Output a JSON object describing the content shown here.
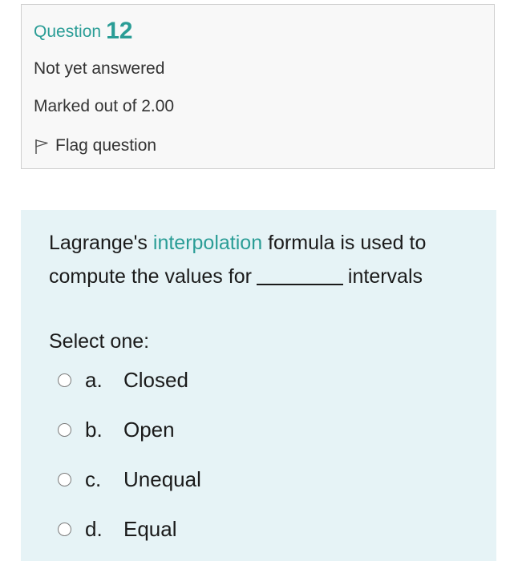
{
  "info": {
    "question_label": "Question",
    "question_number": "12",
    "state": "Not yet answered",
    "grade": "Marked out of 2.00",
    "flag_label": "Flag question"
  },
  "question": {
    "text_before": "Lagrange's",
    "link_word": "interpolation",
    "text_middle": "formula is used to compute the values for",
    "text_after": "intervals",
    "select_prompt": "Select one:"
  },
  "options": [
    {
      "letter": "a.",
      "label": "Closed"
    },
    {
      "letter": "b.",
      "label": "Open"
    },
    {
      "letter": "c.",
      "label": "Unequal"
    },
    {
      "letter": "d.",
      "label": "Equal"
    }
  ],
  "colors": {
    "accent": "#2a9d96",
    "info_background": "#f8f8f8",
    "content_background": "#e6f3f6"
  }
}
